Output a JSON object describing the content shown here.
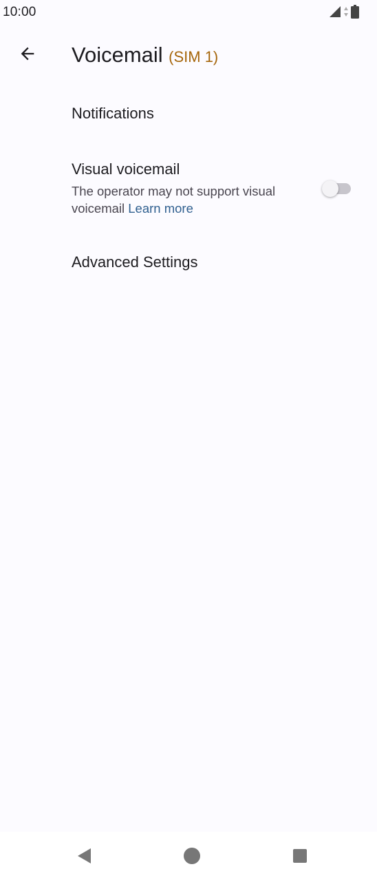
{
  "status_bar": {
    "time": "10:00",
    "icons": [
      "signal-icon",
      "data-arrows-icon",
      "battery-icon"
    ]
  },
  "app_bar": {
    "back_icon": "arrow-back-icon",
    "title": "Voicemail",
    "subtitle": "(SIM 1)"
  },
  "items": {
    "notifications": {
      "title": "Notifications"
    },
    "visual_voicemail": {
      "title": "Visual voicemail",
      "summary": "The operator may not support visual voicemail",
      "link": "Learn more",
      "enabled": false
    },
    "advanced": {
      "title": "Advanced Settings"
    }
  },
  "nav_bar": {
    "buttons": [
      "back-triangle-icon",
      "home-circle-icon",
      "recents-square-icon"
    ]
  },
  "colors": {
    "background": "#fcfbff",
    "accent_sim": "#a5650a",
    "link": "#2f5f8f",
    "text_primary": "#1c1b1f",
    "text_secondary": "#49454f"
  }
}
